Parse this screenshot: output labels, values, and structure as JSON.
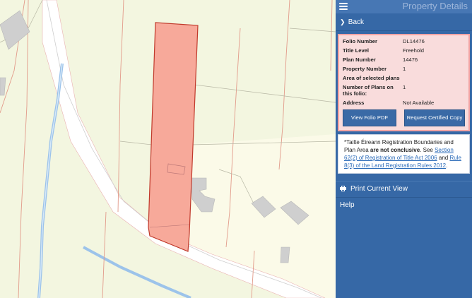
{
  "header": {
    "title": "Property Details"
  },
  "nav": {
    "back_label": "Back",
    "print_label": "Print Current View",
    "help_label": "Help"
  },
  "details": {
    "rows": [
      {
        "key": "Folio Number",
        "value": "DL14476"
      },
      {
        "key": "Title Level",
        "value": "Freehold"
      },
      {
        "key": "Plan Number",
        "value": "14476"
      },
      {
        "key": "Property Number",
        "value": "1"
      },
      {
        "key": "Area of selected plans",
        "value": ""
      },
      {
        "key": "Number of Plans on this folio:",
        "value": "1"
      },
      {
        "key": "Address",
        "value": "Not Available"
      }
    ],
    "view_pdf_label": "View Folio PDF",
    "certified_copy_label": "Request Certified Copy"
  },
  "note": {
    "part1": "*Tailte Éireann Registration Boundaries and Plan Area ",
    "bold": "are not conclusive",
    "part2": ". See ",
    "link1": "Section 62(2) of Registration of Title Act 2006",
    "part3": " and ",
    "link2": "Rule 8(3) of the Land Registration Rules 2012",
    "part4": "."
  },
  "colors": {
    "panel": "#3668a6",
    "parcel_fill": "#f7a99a",
    "parcel_stroke": "#c0392b",
    "map_bg": "#f3f6e0"
  }
}
